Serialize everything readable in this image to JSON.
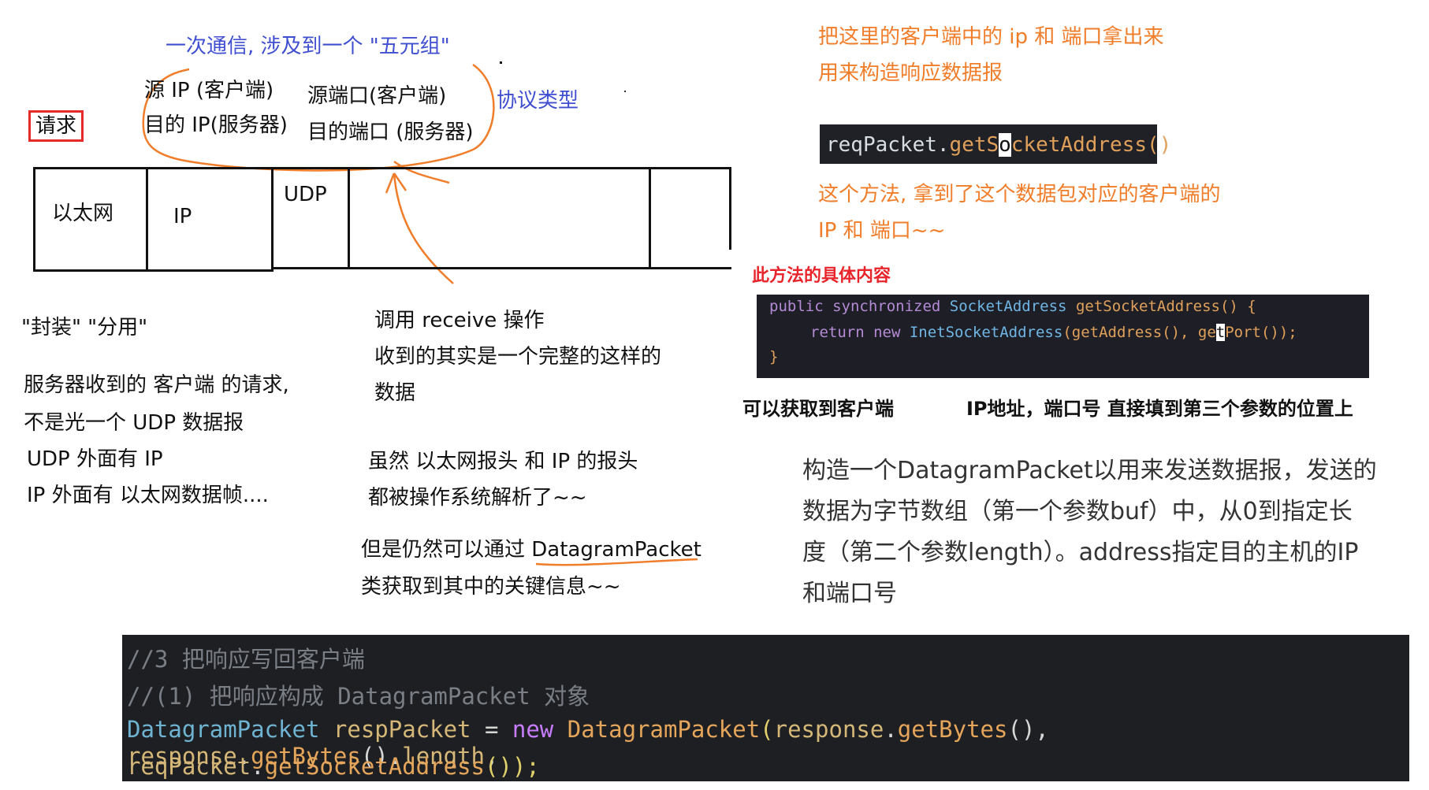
{
  "annotations": {
    "quintuple": "一次通信, 涉及到一个 \"五元组\"",
    "src_ip": "源 IP (客户端)",
    "dst_ip": "目的 IP(服务器)",
    "src_port": "源端口(客户端)",
    "dst_port": "目的端口 (服务器)",
    "protocol": "协议类型",
    "request": "请求"
  },
  "packet": {
    "ethernet": "以太网",
    "ip": "IP",
    "udp": "UDP"
  },
  "left_notes": {
    "encap": "\"封装\" \"分用\"",
    "lines": [
      "服务器收到的 客户端 的请求,",
      "不是光一个 UDP 数据报",
      "UDP 外面有 IP",
      "IP 外面有 以太网数据帧...."
    ]
  },
  "middle_notes": {
    "receive_lines": [
      "调用 receive 操作",
      "收到的其实是一个完整的这样的",
      "数据"
    ],
    "parsed_lines": [
      "虽然 以太网报头 和 IP 的报头",
      "都被操作系统解析了~~"
    ],
    "dp_line1": "但是仍然可以通过 DatagramPacket",
    "dp_line2": "类获取到其中的关键信息~~"
  },
  "right_notes": {
    "take_out_1": "把这里的客户端中的 ip 和 端口拿出来",
    "take_out_2": "用来构造响应数据报",
    "method_1": "这个方法, 拿到了这个数据包对应的客户端的",
    "method_2": "IP 和 端口~~",
    "method_title": "此方法的具体内容",
    "bold_left": "可以获取到客户端",
    "bold_right": "IP地址，端口号 直接填到第三个参数的位置上",
    "desc_lines": [
      "构造一个DatagramPacket以用来发送数据报，发送的",
      "数据为字节数组（第一个参数buf）中，从0到指定长",
      "度（第二个参数length）。address指定目的主机的IP",
      "和端口号"
    ]
  },
  "code_small": {
    "obj": "reqPacket",
    "dot": ".",
    "m1": "getS",
    "cursor": "o",
    "m2": "cketAddress",
    "parens": "()"
  },
  "code_java": {
    "l1_kw": "public synchronized ",
    "l1_type": "SocketAddress ",
    "l1_fn": "getSocketAddress() {",
    "l2_kw": "return new ",
    "l2_type": "InetSocketAddress",
    "l2_rest": "(getAddress(), ge",
    "l2_cursor": "t",
    "l2_end": "Port());",
    "l3": "}"
  },
  "code_bottom": {
    "c1": "//3 把响应写回客户端",
    "c2": "//(1) 把响应构成 DatagramPacket 对象",
    "l3_type": "DatagramPacket ",
    "l3_var": "respPacket ",
    "l3_eq": "= ",
    "l3_new": "new ",
    "l3_cls": "DatagramPacket",
    "l3_open": "(",
    "l3_resp1": "response",
    "l3_dot1": ".",
    "l3_fn1": "getBytes",
    "l3_p1": "(), ",
    "l3_resp2": "response",
    "l3_dot2": ".",
    "l3_fn2": "getBytes",
    "l3_p2": "().",
    "l3_len": "length",
    "l3_comma": ",",
    "l4_var": "reqPacket",
    "l4_dot": ".",
    "l4_fn": "getSocketAddress",
    "l4_end": "());"
  }
}
